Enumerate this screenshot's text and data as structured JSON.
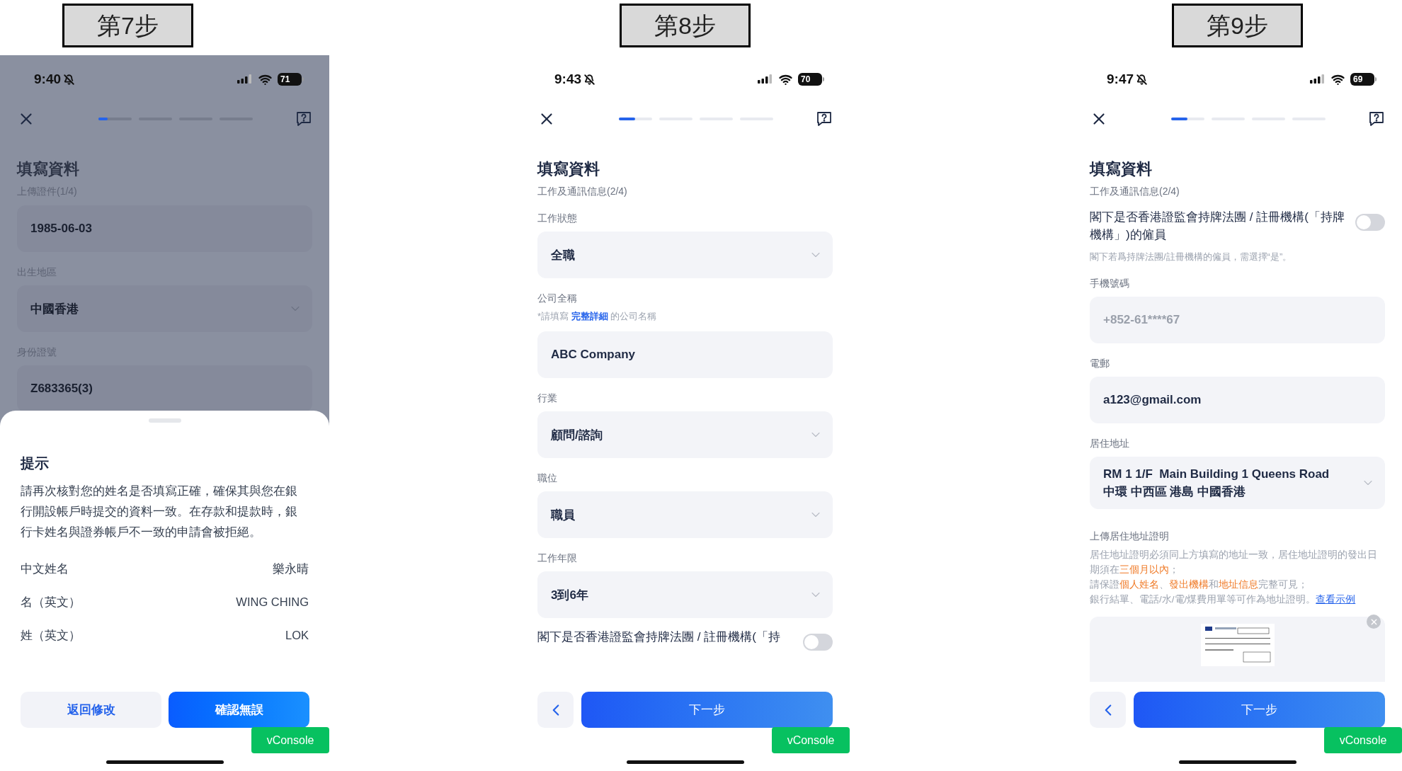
{
  "steps": [
    {
      "label": "第7步",
      "dimmed": true,
      "status": {
        "time": "9:40",
        "battery": "71"
      },
      "progress": {
        "level": 0.06
      },
      "title": "填寫資料",
      "subtitle": "上傳證件(1/4)",
      "fields": [
        {
          "kind": "input",
          "value": "1985-06-03",
          "disabled": false
        },
        {
          "kind": "select",
          "label": "出生地區",
          "value": "中國香港"
        },
        {
          "kind": "input",
          "label": "身份證號",
          "value": "Z683365(3)",
          "disabled": false
        }
      ],
      "sheet": {
        "title": "提示",
        "body": "請再次核對您的姓名是否填寫正確，確保其與您在銀行開設帳戶時提交的資料一致。在存款和提款時，銀行卡姓名與證券帳戶不一致的申請會被拒絕。",
        "rows": [
          {
            "label": "中文姓名",
            "value": "樂永晴"
          },
          {
            "label": "名（英文）",
            "value": "WING CHING"
          },
          {
            "label": "姓（英文）",
            "value": "LOK"
          }
        ],
        "buttons": [
          {
            "kind": "secondary",
            "label": "返回修改"
          },
          {
            "kind": "primary",
            "label": "確認無誤"
          }
        ]
      },
      "vconsole": "vConsole"
    },
    {
      "label": "第8步",
      "dimmed": false,
      "status": {
        "time": "9:43",
        "battery": "70"
      },
      "progress": {
        "level": 0.11
      },
      "title": "填寫資料",
      "subtitle": "工作及通訊信息(2/4)",
      "fields": [
        {
          "kind": "select",
          "label": "工作狀態",
          "value": "全職"
        },
        {
          "kind": "input",
          "label": "公司全稱",
          "hint": "*請填寫 **完整詳細** 的公司名稱",
          "value": "ABC Company",
          "disabled": false
        },
        {
          "kind": "select",
          "label": "行業",
          "value": "顧問/諮詢"
        },
        {
          "kind": "select",
          "label": "職位",
          "value": "職員"
        },
        {
          "kind": "select",
          "label": "工作年限",
          "value": "3到6年"
        },
        {
          "kind": "toggle",
          "text": "閣下是否香港證監會持牌法團 / 註冊機構(「持",
          "on": false
        }
      ],
      "next": "下一步",
      "vconsole": "vConsole"
    },
    {
      "label": "第9步",
      "dimmed": false,
      "status": {
        "time": "9:47",
        "battery": "69"
      },
      "progress": {
        "level": 0.11
      },
      "title": "填寫資料",
      "subtitle": "工作及通訊信息(2/4)",
      "fields": [
        {
          "kind": "toggle",
          "text": "閣下是否香港證監會持牌法團 / 註冊機構(「持牌機構」)的僱員",
          "note": "閣下若爲持牌法團/註冊機構的僱員，需選擇“是”。",
          "on": false
        },
        {
          "kind": "input",
          "label": "手機號碼",
          "value": "+852-61****67",
          "disabled": true
        },
        {
          "kind": "input",
          "label": "電郵",
          "value": "a123@gmail.com",
          "disabled": false
        },
        {
          "kind": "select",
          "label": "居住地址",
          "lines": [
            "RM 1 1/F  Main Building 1 Queens Road",
            "中環 中西區 港島 中國香港"
          ]
        },
        {
          "kind": "upload",
          "label": "上傳居住地址證明",
          "notes": [
            "居住地址證明必須同上方填寫的地址一致，居住地址證明的發出日期須在**三個月以內**；",
            "請保證**個人姓名**、**發出機構**和**地址信息**完整可見；",
            "銀行結單、電話/水/電/煤費用單等可作為地址證明。"
          ],
          "link": "查看示例"
        }
      ],
      "next": "下一步",
      "vconsole": "vConsole"
    }
  ]
}
